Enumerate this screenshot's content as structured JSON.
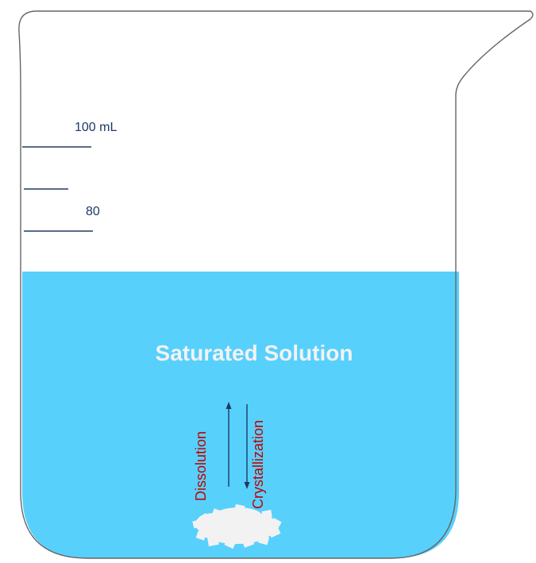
{
  "beaker": {
    "marks": {
      "top_label": "100 mL",
      "lower_label": "80"
    },
    "solution_label": "Saturated Solution",
    "process": {
      "up_label": "Dissolution",
      "down_label": "Crystallization"
    }
  },
  "colors": {
    "solution": "#57D0FC",
    "outline": "#666666",
    "graduation": "#1F3864",
    "arrow": "#1F3864",
    "process_text": "#C00000",
    "solution_text": "#F2F2F2",
    "solid": "#F2F2F2"
  },
  "icons": {
    "solid": "crystal-pile-icon",
    "up_arrow": "up-arrow-icon",
    "down_arrow": "down-arrow-icon"
  }
}
